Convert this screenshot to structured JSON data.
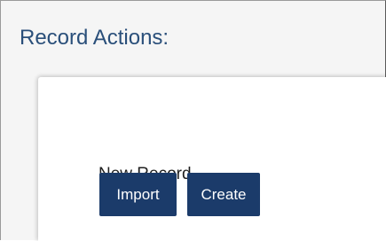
{
  "panel": {
    "title": "Record Actions:"
  },
  "new_record": {
    "label": "New Record",
    "import_label": "Import",
    "create_label": "Create"
  },
  "colors": {
    "title_text": "#2a4f7a",
    "button_background": "#1b3b6a",
    "button_text": "#ffffff",
    "panel_background": "#f5f5f5",
    "card_background": "#ffffff"
  }
}
